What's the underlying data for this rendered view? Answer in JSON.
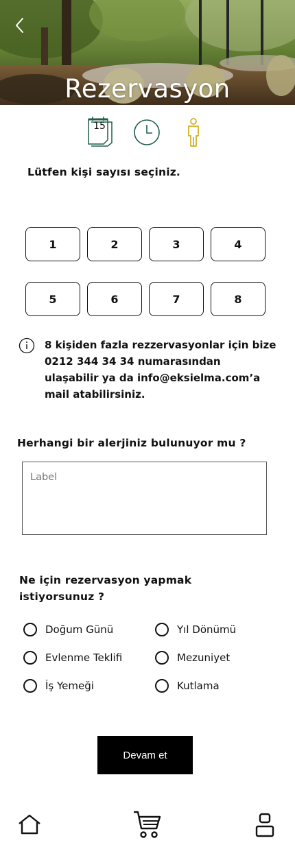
{
  "header": {
    "title": "Rezervasyon",
    "back_icon": "chevron-left-icon"
  },
  "steps": {
    "date_day": "15",
    "date_icon": "calendar-icon",
    "time_icon": "clock-icon",
    "people_icon": "person-icon",
    "accent_color": "#1f5f4a",
    "active_color": "#c8a400"
  },
  "people": {
    "question": "Lütfen kişi sayısı seçiniz.",
    "options": [
      "1",
      "2",
      "3",
      "4",
      "5",
      "6",
      "7",
      "8"
    ]
  },
  "info": {
    "icon": "info-icon",
    "text": "8 kişiden fazla rezzervasyonlar için bize 0212 344 34 34 numarasından ulaşabilir ya da info@eksielma.com’a mail atabilirsiniz."
  },
  "allergy": {
    "question": "Herhangi bir alerjiniz bulunuyor mu ?",
    "placeholder": "Label"
  },
  "occasion": {
    "question": "Ne için rezervasyon yapmak istiyorsunuz ?",
    "options": [
      "Doğum Günü",
      "Yıl Dönümü",
      "Evlenme Teklifi",
      "Mezuniyet",
      "İş Yemeği",
      "Kutlama"
    ]
  },
  "actions": {
    "continue_label": "Devam et"
  },
  "bottom_nav": {
    "home_icon": "home-icon",
    "cart_icon": "cart-icon",
    "profile_icon": "profile-icon"
  }
}
